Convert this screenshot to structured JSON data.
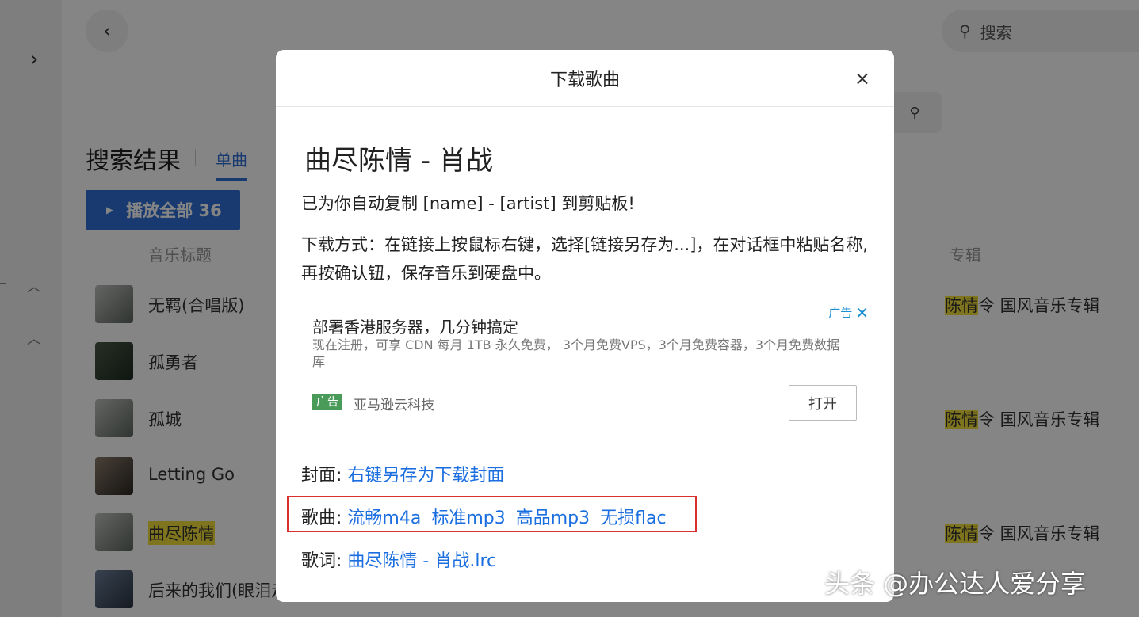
{
  "header": {
    "search_placeholder": "搜索"
  },
  "results": {
    "title": "搜索结果",
    "tab_single": "单曲",
    "play_all": "播放全部 36",
    "col_title": "音乐标题",
    "col_album": "专辑",
    "songs": [
      {
        "name": "无羁(合唱版)",
        "album_hl": "陈情",
        "album_rest": "令 国风音乐专辑"
      },
      {
        "name": "孤勇者",
        "album_hl": "",
        "album_rest": ""
      },
      {
        "name": "孤城",
        "album_hl": "陈情",
        "album_rest": "令 国风音乐专辑"
      },
      {
        "name": "Letting Go",
        "album_hl": "",
        "album_rest": ""
      },
      {
        "name": "曲尽陈情",
        "album_hl": "陈情",
        "album_rest": "令 国风音乐专辑"
      },
      {
        "name": "后来的我们(眼泪走",
        "album_hl": "",
        "album_rest": ""
      }
    ]
  },
  "dialog": {
    "title": "下载歌曲",
    "close": "×",
    "song_heading": "曲尽陈情 - 肖战",
    "copied_msg": "已为你自动复制 [name] - [artist] 到剪贴板!",
    "instructions": "下载方式：在链接上按鼠标右键，选择[链接另存为...]，在对话框中粘贴名称,再按确认钮，保存音乐到硬盘中。",
    "ad": {
      "label": "广告",
      "title": "部署香港服务器，几分钟搞定",
      "desc": "现在注册，可享 CDN 每月 1TB 永久免费， 3个月免费VPS，3个月免费容器，3个月免费数据库",
      "badge": "广告",
      "sponsor": "亚马逊云科技",
      "open_button": "打开"
    },
    "cover_label": "封面:",
    "cover_link": "右键另存为下载封面",
    "song_label": "歌曲:",
    "song_links": [
      "流畅m4a",
      "标准mp3",
      "高品mp3",
      "无损flac"
    ],
    "lyrics_label": "歌词:",
    "lyrics_link": "曲尽陈情 - 肖战.lrc"
  },
  "watermark": "头条 @办公达人爱分享",
  "colors": {
    "accent": "#2f6fd6",
    "link": "#1a6ee0",
    "highlight": "#f3e03a",
    "red_box": "#d93030",
    "ad_badge": "#4a9a5a"
  }
}
